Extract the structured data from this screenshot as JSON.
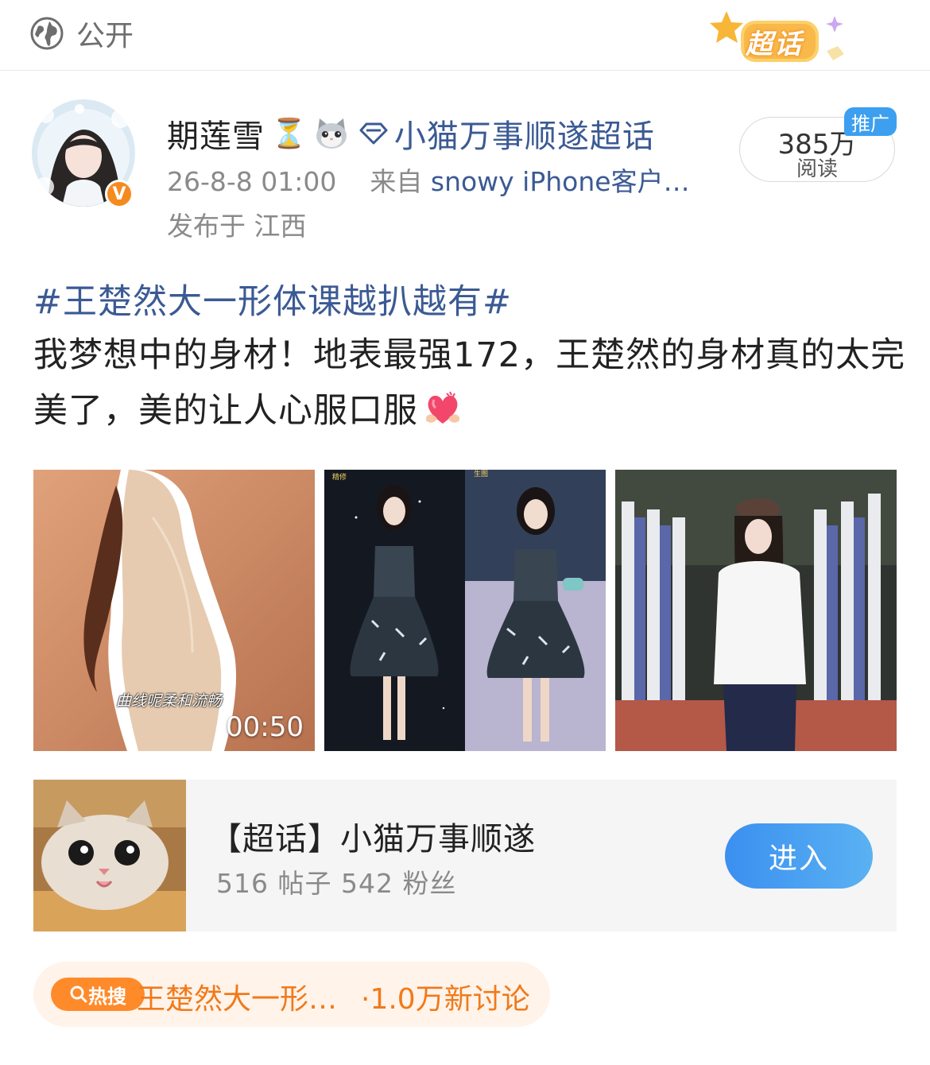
{
  "header": {
    "visibility_label": "公开",
    "visibility_icon": "globe-icon",
    "supertopic_badge": "超话"
  },
  "post": {
    "author": {
      "name": "期莲雪",
      "verified_mark": "V",
      "name_emoji": "⏳"
    },
    "supertopic_link": "小猫万事顺遂超话",
    "time": "26-8-8 01:00",
    "source_prefix": "来自",
    "source": "snowy iPhone客户…",
    "location": "发布于 江西",
    "reads": {
      "count": "385万",
      "label": "阅读",
      "promo_tag": "推广"
    },
    "hashtag": "#王楚然大一形体课越扒越有#",
    "text": "我梦想中的身材！地表最强172，王楚然的身材真的太完美了，美的让人心服口服",
    "media": [
      {
        "type": "video",
        "caption": "曲线呢柔和流畅",
        "duration": "00:50"
      },
      {
        "type": "image",
        "tags": [
          "精修",
          "生图"
        ]
      },
      {
        "type": "image"
      }
    ]
  },
  "topic_card": {
    "title": "【超话】小猫万事顺遂",
    "stats": "516 帖子  542 粉丝",
    "enter_label": "进入"
  },
  "hot_search": {
    "badge": "热搜",
    "title": "王楚然大一形…",
    "count": "·1.0万新讨论"
  },
  "colors": {
    "link_blue": "#3b5a94",
    "accent_orange": "#f58a1f",
    "enter_button": "#3b8ff0",
    "hot_text": "#f07a1a"
  }
}
